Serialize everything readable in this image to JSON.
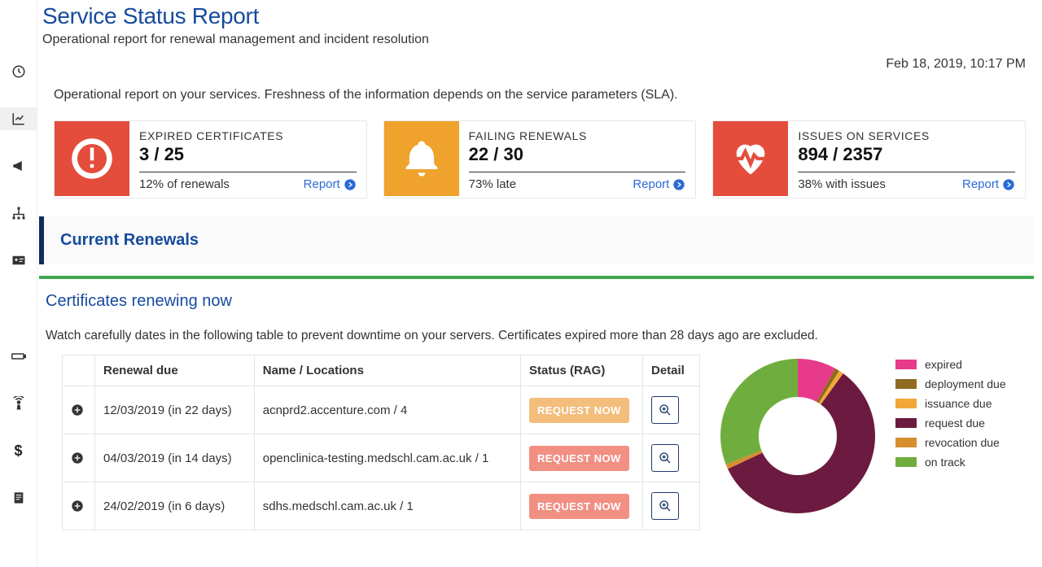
{
  "colors": {
    "brand_blue": "#164b9e",
    "link_blue": "#2a6ad6",
    "card_red": "#e44c3c",
    "card_orange": "#efa22c",
    "green_rule": "#3fa84f",
    "btn_warn": "#f3bd7c",
    "btn_danger": "#f18f83",
    "detail_border": "#1c3a6e"
  },
  "header": {
    "title": "Service Status Report",
    "subtitle": "Operational report for renewal management and incident resolution",
    "timestamp": "Feb 18, 2019, 10:17 PM"
  },
  "intro": "Operational report on your services. Freshness of the information depends on the service parameters (SLA).",
  "cards": [
    {
      "icon": "exclamation-circle",
      "color": "red",
      "label": "EXPIRED CERTIFICATES",
      "value": "3 / 25",
      "foot": "12% of renewals",
      "report_label": "Report"
    },
    {
      "icon": "bell",
      "color": "orange",
      "label": "FAILING RENEWALS",
      "value": "22 / 30",
      "foot": "73% late",
      "report_label": "Report"
    },
    {
      "icon": "heartbeat",
      "color": "red",
      "label": "ISSUES ON SERVICES",
      "value": "894 / 2357",
      "foot": "38% with issues",
      "report_label": "Report"
    }
  ],
  "section": {
    "current_renewals_title": "Current Renewals",
    "subsection_title": "Certificates renewing now",
    "note": "Watch carefully dates in the following table to prevent downtime on your servers. Certificates expired more than 28 days ago are excluded."
  },
  "table": {
    "headers": {
      "due": "Renewal due",
      "name": "Name / Locations",
      "status": "Status (RAG)",
      "detail": "Detail"
    },
    "rows": [
      {
        "due": "12/03/2019 (in 22 days)",
        "name": "acnprd2.accenture.com / 4",
        "button": "REQUEST NOW",
        "btn_class": "warn"
      },
      {
        "due": "04/03/2019 (in 14 days)",
        "name": "openclinica-testing.medschl.cam.ac.uk / 1",
        "button": "REQUEST NOW",
        "btn_class": ""
      },
      {
        "due": "24/02/2019 (in 6 days)",
        "name": "sdhs.medschl.cam.ac.uk / 1",
        "button": "REQUEST NOW",
        "btn_class": ""
      }
    ]
  },
  "chart_data": {
    "type": "pie",
    "title": "",
    "series": [
      {
        "name": "expired",
        "value": 8,
        "color": "#e83a8a"
      },
      {
        "name": "deployment due",
        "value": 1,
        "color": "#8f6a1f"
      },
      {
        "name": "issuance due",
        "value": 1,
        "color": "#f2a838"
      },
      {
        "name": "request due",
        "value": 58,
        "color": "#6c1a3f"
      },
      {
        "name": "revocation due",
        "value": 1,
        "color": "#d88d2e"
      },
      {
        "name": "on track",
        "value": 31,
        "color": "#6fae3e"
      }
    ]
  }
}
